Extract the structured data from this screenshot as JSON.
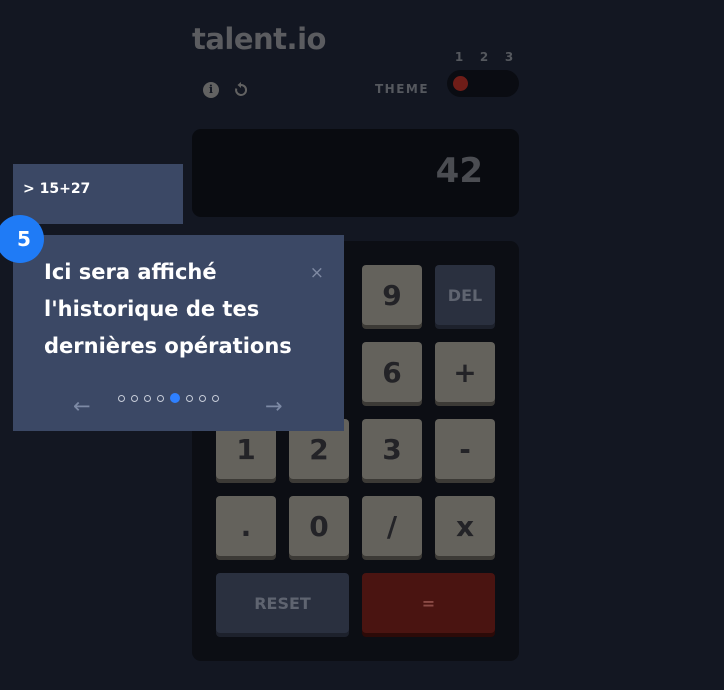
{
  "app": {
    "logo": "talent.io"
  },
  "toolbar": {
    "info_icon": "info-icon",
    "reset_icon": "reset-icon"
  },
  "theme": {
    "label": "THEME",
    "options": [
      "1",
      "2",
      "3"
    ],
    "selected": "1",
    "knob_color": "#6f1d18"
  },
  "display": {
    "value": "42"
  },
  "history": {
    "entry": "> 15+27"
  },
  "keypad": {
    "keys": [
      {
        "label": "9",
        "name": "key-9"
      },
      {
        "label": "DEL",
        "name": "key-del"
      },
      {
        "label": "6",
        "name": "key-6"
      },
      {
        "label": "+",
        "name": "key-plus"
      },
      {
        "label": "1",
        "name": "key-1"
      },
      {
        "label": "2",
        "name": "key-2"
      },
      {
        "label": "3",
        "name": "key-3"
      },
      {
        "label": "-",
        "name": "key-minus"
      },
      {
        "label": ".",
        "name": "key-decimal"
      },
      {
        "label": "0",
        "name": "key-0"
      },
      {
        "label": "/",
        "name": "key-divide"
      },
      {
        "label": "x",
        "name": "key-multiply"
      },
      {
        "label": "RESET",
        "name": "key-reset"
      },
      {
        "label": "=",
        "name": "key-equals"
      }
    ]
  },
  "tour": {
    "step_number": "5",
    "text": "Ici sera affiché l'historique de tes dernières opérations",
    "close": "×",
    "prev": "←",
    "next": "→",
    "total_steps": 8,
    "current_step": 5
  },
  "colors": {
    "accent": "#1f7bf6",
    "background": "#131722",
    "tooltip": "#3b4865"
  }
}
